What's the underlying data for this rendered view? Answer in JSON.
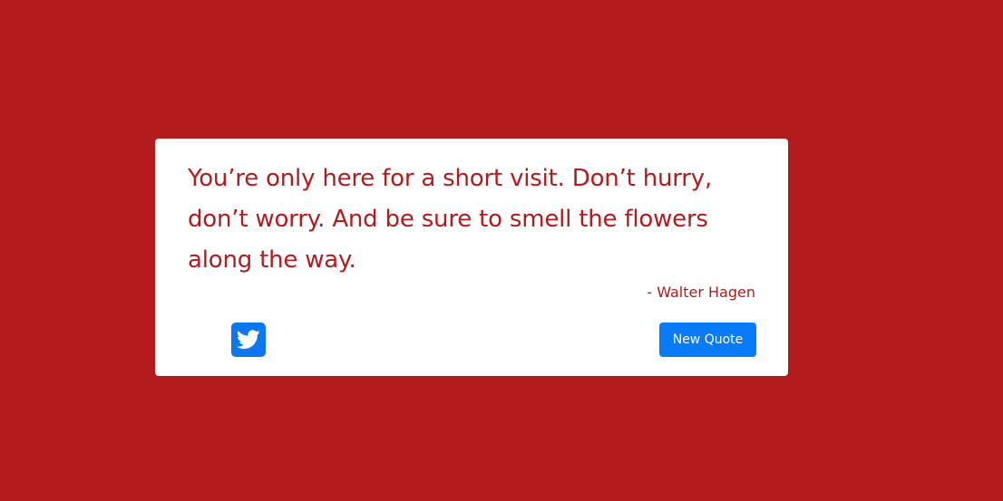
{
  "quote": {
    "text": "You’re only here for a short visit. Don’t hurry, don’t worry. And be sure to smell the flowers along the way.",
    "author": "- Walter Hagen"
  },
  "actions": {
    "tweet_icon": "twitter-icon",
    "new_quote_label": "New Quote"
  },
  "colors": {
    "background": "#b41b1d",
    "card": "#ffffff",
    "quote_text": "#b41b1d",
    "tweet_button": "#0d78ee",
    "new_quote_button": "#0a7bf7"
  }
}
